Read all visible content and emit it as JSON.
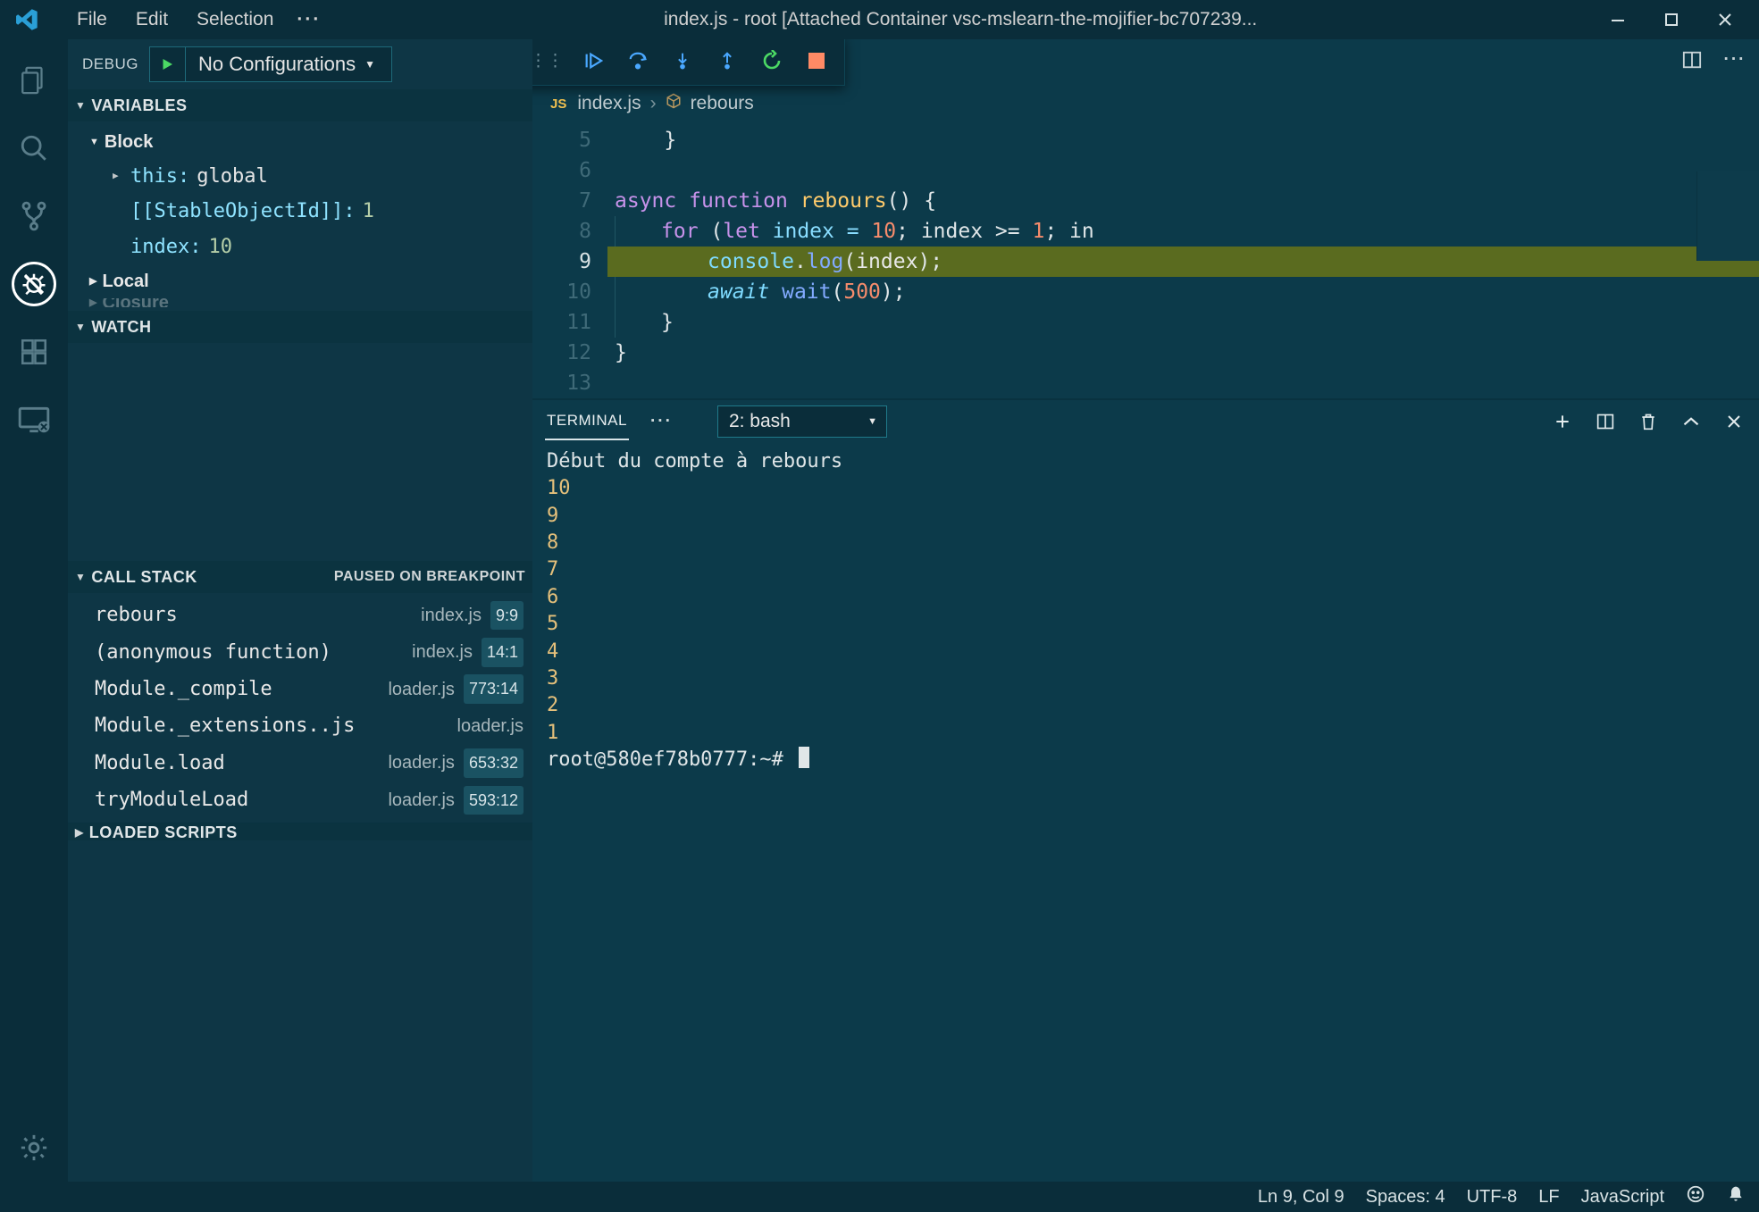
{
  "title": "index.js - root [Attached Container vsc-mslearn-the-mojifier-bc707239...",
  "menu": {
    "file": "File",
    "edit": "Edit",
    "selection": "Selection"
  },
  "debug": {
    "label": "DEBUG",
    "config": "No Configurations"
  },
  "sections": {
    "variables": {
      "title": "VARIABLES",
      "scopes": {
        "block": {
          "label": "Block"
        },
        "local": {
          "label": "Local"
        },
        "closure_cut": {
          "label": "Closure"
        }
      },
      "vars": {
        "this_key": "this:",
        "this_val": "global",
        "stable_key": "[[StableObjectId]]:",
        "stable_val": "1",
        "index_key": "index:",
        "index_val": "10"
      }
    },
    "watch": {
      "title": "WATCH"
    },
    "callstack": {
      "title": "CALL STACK",
      "status": "PAUSED ON BREAKPOINT",
      "frames": [
        {
          "name": "rebours",
          "file": "index.js",
          "pos": "9:9"
        },
        {
          "name": "(anonymous function)",
          "file": "index.js",
          "pos": "14:1"
        },
        {
          "name": "Module._compile",
          "file": "loader.js",
          "pos": "773:14"
        },
        {
          "name": "Module._extensions..js",
          "file": "loader.js",
          "pos": ""
        },
        {
          "name": "Module.load",
          "file": "loader.js",
          "pos": "653:32"
        },
        {
          "name": "tryModuleLoad",
          "file": "loader.js",
          "pos": "593:12"
        }
      ]
    },
    "loaded": {
      "title": "LOADED SCRIPTS"
    }
  },
  "breadcrumb": {
    "jsLabel": "JS",
    "file": "index.js",
    "symbol": "rebours"
  },
  "code": {
    "lines": {
      "5": "    }",
      "6": "",
      "7a": "async ",
      "7b": "function ",
      "7c": "rebours",
      "7d": "() {",
      "8a": "for ",
      "8b": "(",
      "8c": "let ",
      "8d": "index ",
      "8e": "= ",
      "8f": "10",
      "8g": "; index >= ",
      "8h": "1",
      "8i": "; in",
      "9a": "console",
      "9b": ".",
      "9c": "log",
      "9d": "(",
      "9e": "index",
      "9f": ");",
      "10a": "await ",
      "10b": "wait",
      "10c": "(",
      "10d": "500",
      "10e": ");",
      "11": "}",
      "12": "}",
      "13": ""
    }
  },
  "terminal": {
    "tab": "TERMINAL",
    "select": "2: bash",
    "lines": [
      {
        "text": "Début du compte à rebours",
        "cls": "tc-default"
      },
      {
        "text": "10",
        "cls": "tc-yellow"
      },
      {
        "text": "9",
        "cls": "tc-yellow"
      },
      {
        "text": "8",
        "cls": "tc-yellow"
      },
      {
        "text": "7",
        "cls": "tc-yellow"
      },
      {
        "text": "6",
        "cls": "tc-yellow"
      },
      {
        "text": "5",
        "cls": "tc-yellow"
      },
      {
        "text": "4",
        "cls": "tc-yellow"
      },
      {
        "text": "3",
        "cls": "tc-yellow"
      },
      {
        "text": "2",
        "cls": "tc-yellow"
      },
      {
        "text": "1",
        "cls": "tc-yellow"
      }
    ],
    "prompt": "root@580ef78b0777:~# "
  },
  "status": {
    "pos": "Ln 9, Col 9",
    "spaces": "Spaces: 4",
    "encoding": "UTF-8",
    "eol": "LF",
    "language": "JavaScript"
  }
}
